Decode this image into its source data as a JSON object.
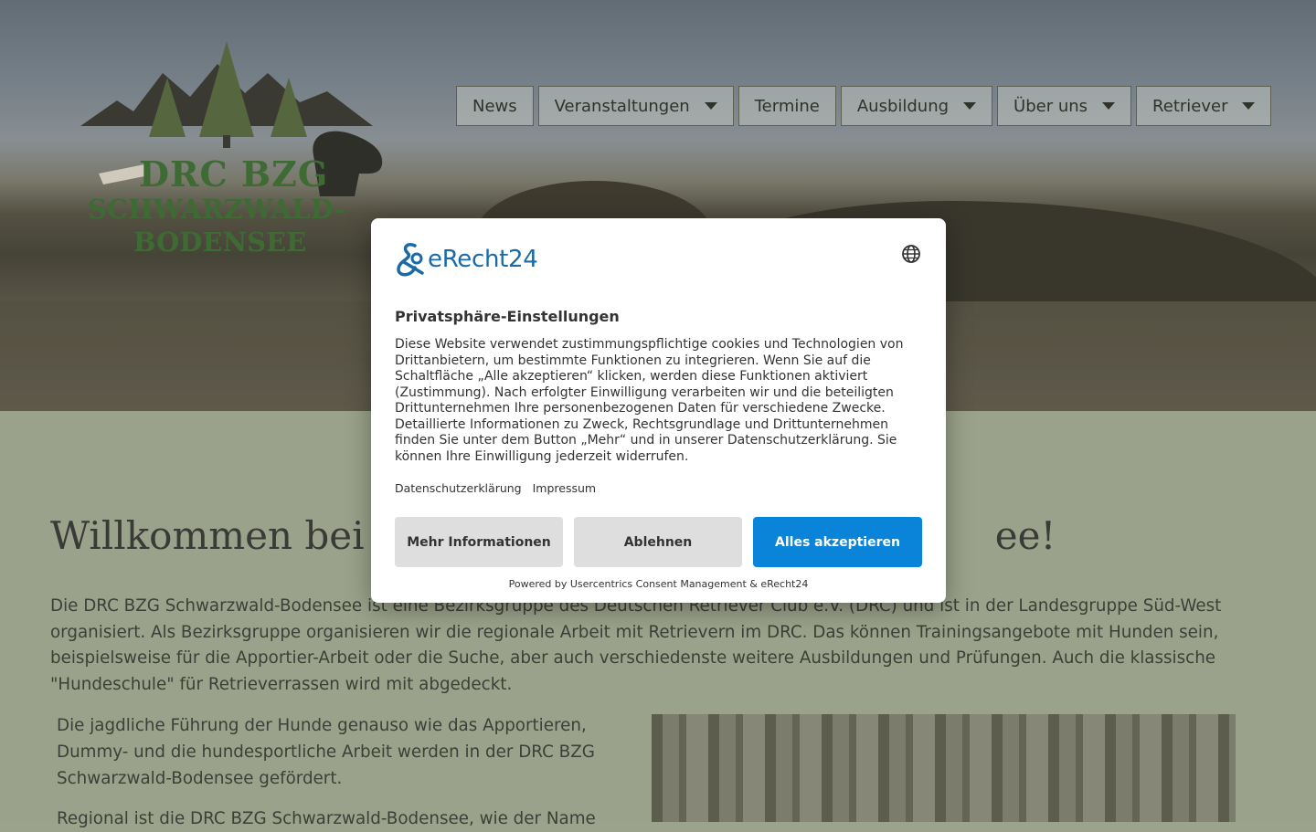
{
  "logo": {
    "line1": "DRC BZG",
    "line2": "SCHWARZWALD-",
    "line3": "BODENSEE",
    "colors": {
      "green": "#3e6b34",
      "dark": "#3a3a33"
    }
  },
  "nav": {
    "items": [
      {
        "label": "News",
        "dropdown": false
      },
      {
        "label": "Veranstaltungen",
        "dropdown": true
      },
      {
        "label": "Termine",
        "dropdown": false
      },
      {
        "label": "Ausbildung",
        "dropdown": true
      },
      {
        "label": "Über uns",
        "dropdown": true
      },
      {
        "label": "Retriever",
        "dropdown": true
      }
    ]
  },
  "main": {
    "heading_visible_left": "Willkommen bei d",
    "heading_visible_right": "ee!",
    "intro": "Die DRC BZG Schwarzwald-Bodensee ist eine Bezirksgruppe des Deutschen Retriever Club e.V. (DRC) und ist in der Landesgruppe Süd-West organisiert. Als Bezirksgruppe organisieren wir die regionale Arbeit mit Retrievern im DRC. Das können Trainingsangebote mit Hunden sein, beispielsweise für die Apportier-Arbeit oder die Suche, aber auch verschiedenste weitere Ausbildungen und Prüfungen. Auch die klassische \"Hundeschule\" für Retrieverrassen wird mit abgedeckt.",
    "paragraph2": "Die jagdliche Führung der Hunde genauso wie das Apportieren, Dummy- und die hundesportliche Arbeit werden in der DRC BZG Schwarzwald-Bodensee gefördert.",
    "paragraph3_partial": "Regional ist die DRC BZG Schwarzwald-Bodensee, wie der Name"
  },
  "consent": {
    "brand": "eRecht24",
    "language_icon": "globe-icon",
    "title": "Privatsphäre-Einstellungen",
    "text": "Diese Website verwendet zustimmungspflichtige cookies und Technologien von Drittanbietern, um bestimmte Funktionen zu integrieren. Wenn Sie auf die Schaltfläche „Alle akzeptieren“ klicken, werden diese Funktionen aktiviert (Zustimmung). Nach erfolgter Einwilligung verarbeiten wir und die beteiligten Drittunternehmen Ihre personenbezogenen Daten für verschiedene Zwecke. Detaillierte Informationen zu Zweck, Rechtsgrundlage und Drittunternehmen finden Sie unter dem Button „Mehr“ und in unserer Datenschutzerklärung. Sie können Ihre Einwilligung jederzeit widerrufen.",
    "link_privacy": "Datenschutzerklärung",
    "link_imprint": "Impressum",
    "btn_more": "Mehr Informationen",
    "btn_decline": "Ablehnen",
    "btn_accept": "Alles akzeptieren",
    "powered_by": "Powered by Usercentrics Consent Management & eRecht24",
    "colors": {
      "accent": "#0a84d8",
      "secondary_btn": "#dedede"
    }
  }
}
